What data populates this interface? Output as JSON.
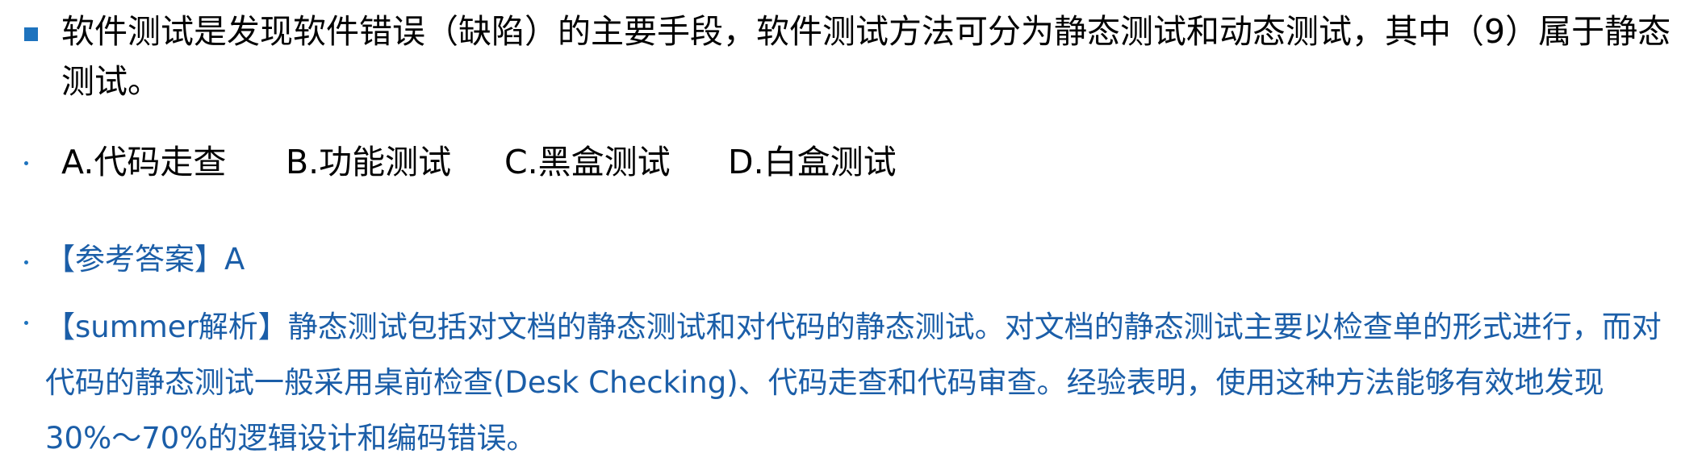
{
  "question": {
    "text": "软件测试是发现软件错误（缺陷）的主要手段，软件测试方法可分为静态测试和动态测试，其中（9）属于静态测试。"
  },
  "options": [
    "A.代码走查",
    "B.功能测试",
    "C.黑盒测试",
    "D.白盒测试"
  ],
  "answer": {
    "text": "【参考答案】A"
  },
  "analysis": {
    "text": "【summer解析】静态测试包括对文档的静态测试和对代码的静态测试。对文档的静态测试主要以检查单的形式进行，而对代码的静态测试一般采用桌前检查(Desk Checking)、代码走查和代码审查。经验表明，使用这种方法能够有效地发现 30%～70%的逻辑设计和编码错误。"
  },
  "colors": {
    "accent": "#1e73be",
    "answer_text": "#1b5ea8",
    "question_text": "#000000"
  }
}
